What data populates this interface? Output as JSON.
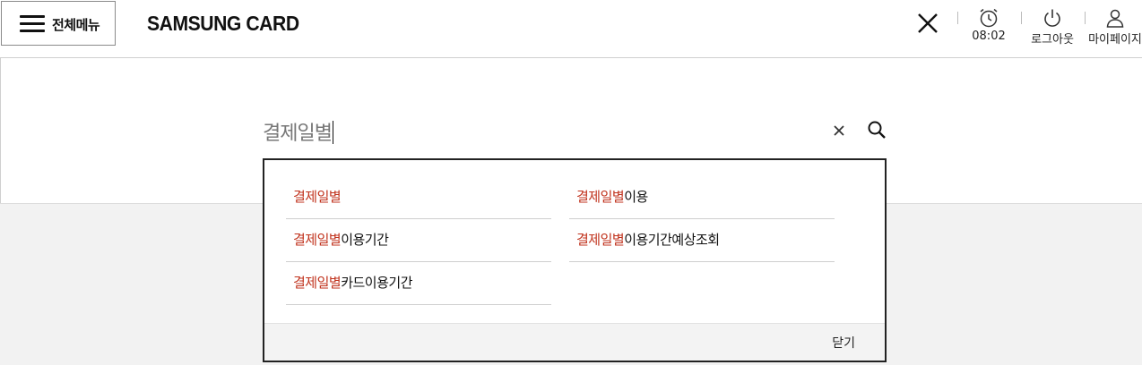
{
  "header": {
    "menu_label": "전체메뉴",
    "logo_text": "SAMSUNG CARD",
    "timer_value": "08:02",
    "logout_label": "로그아웃",
    "mypage_label": "마이페이지"
  },
  "search": {
    "query": "결제일별"
  },
  "suggestions": {
    "left": [
      {
        "match": "결제일별",
        "rest": ""
      },
      {
        "match": "결제일별",
        "rest": "이용기간"
      },
      {
        "match": "결제일별",
        "rest": "카드이용기간"
      }
    ],
    "right": [
      {
        "match": "결제일별",
        "rest": "이용"
      },
      {
        "match": "결제일별",
        "rest": "이용기간예상조회"
      }
    ],
    "close_label": "닫기"
  },
  "colors": {
    "highlight": "#c0321c",
    "border": "#222222"
  }
}
